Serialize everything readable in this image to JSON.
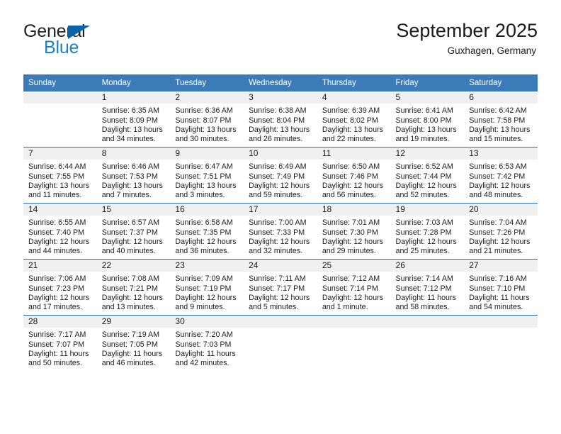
{
  "brand": {
    "name_top": "General",
    "name_bottom": "Blue",
    "accent_color": "#1f7fc4",
    "triangle_color": "#0b63a8",
    "triangle_icon": "triangle-icon"
  },
  "header": {
    "title": "September 2025",
    "subtitle": "Guxhagen, Germany"
  },
  "theme": {
    "header_bg": "#3b7cb8",
    "row_divider": "#2e6da4",
    "daynum_bg": "#f0f0f0",
    "text": "#1a1a1a"
  },
  "weekday_headers": [
    "Sunday",
    "Monday",
    "Tuesday",
    "Wednesday",
    "Thursday",
    "Friday",
    "Saturday"
  ],
  "weeks": [
    [
      {
        "day": "",
        "lines": []
      },
      {
        "day": "1",
        "lines": [
          "Sunrise: 6:35 AM",
          "Sunset: 8:09 PM",
          "Daylight: 13 hours",
          "and 34 minutes."
        ]
      },
      {
        "day": "2",
        "lines": [
          "Sunrise: 6:36 AM",
          "Sunset: 8:07 PM",
          "Daylight: 13 hours",
          "and 30 minutes."
        ]
      },
      {
        "day": "3",
        "lines": [
          "Sunrise: 6:38 AM",
          "Sunset: 8:04 PM",
          "Daylight: 13 hours",
          "and 26 minutes."
        ]
      },
      {
        "day": "4",
        "lines": [
          "Sunrise: 6:39 AM",
          "Sunset: 8:02 PM",
          "Daylight: 13 hours",
          "and 22 minutes."
        ]
      },
      {
        "day": "5",
        "lines": [
          "Sunrise: 6:41 AM",
          "Sunset: 8:00 PM",
          "Daylight: 13 hours",
          "and 19 minutes."
        ]
      },
      {
        "day": "6",
        "lines": [
          "Sunrise: 6:42 AM",
          "Sunset: 7:58 PM",
          "Daylight: 13 hours",
          "and 15 minutes."
        ]
      }
    ],
    [
      {
        "day": "7",
        "lines": [
          "Sunrise: 6:44 AM",
          "Sunset: 7:55 PM",
          "Daylight: 13 hours",
          "and 11 minutes."
        ]
      },
      {
        "day": "8",
        "lines": [
          "Sunrise: 6:46 AM",
          "Sunset: 7:53 PM",
          "Daylight: 13 hours",
          "and 7 minutes."
        ]
      },
      {
        "day": "9",
        "lines": [
          "Sunrise: 6:47 AM",
          "Sunset: 7:51 PM",
          "Daylight: 13 hours",
          "and 3 minutes."
        ]
      },
      {
        "day": "10",
        "lines": [
          "Sunrise: 6:49 AM",
          "Sunset: 7:49 PM",
          "Daylight: 12 hours",
          "and 59 minutes."
        ]
      },
      {
        "day": "11",
        "lines": [
          "Sunrise: 6:50 AM",
          "Sunset: 7:46 PM",
          "Daylight: 12 hours",
          "and 56 minutes."
        ]
      },
      {
        "day": "12",
        "lines": [
          "Sunrise: 6:52 AM",
          "Sunset: 7:44 PM",
          "Daylight: 12 hours",
          "and 52 minutes."
        ]
      },
      {
        "day": "13",
        "lines": [
          "Sunrise: 6:53 AM",
          "Sunset: 7:42 PM",
          "Daylight: 12 hours",
          "and 48 minutes."
        ]
      }
    ],
    [
      {
        "day": "14",
        "lines": [
          "Sunrise: 6:55 AM",
          "Sunset: 7:40 PM",
          "Daylight: 12 hours",
          "and 44 minutes."
        ]
      },
      {
        "day": "15",
        "lines": [
          "Sunrise: 6:57 AM",
          "Sunset: 7:37 PM",
          "Daylight: 12 hours",
          "and 40 minutes."
        ]
      },
      {
        "day": "16",
        "lines": [
          "Sunrise: 6:58 AM",
          "Sunset: 7:35 PM",
          "Daylight: 12 hours",
          "and 36 minutes."
        ]
      },
      {
        "day": "17",
        "lines": [
          "Sunrise: 7:00 AM",
          "Sunset: 7:33 PM",
          "Daylight: 12 hours",
          "and 32 minutes."
        ]
      },
      {
        "day": "18",
        "lines": [
          "Sunrise: 7:01 AM",
          "Sunset: 7:30 PM",
          "Daylight: 12 hours",
          "and 29 minutes."
        ]
      },
      {
        "day": "19",
        "lines": [
          "Sunrise: 7:03 AM",
          "Sunset: 7:28 PM",
          "Daylight: 12 hours",
          "and 25 minutes."
        ]
      },
      {
        "day": "20",
        "lines": [
          "Sunrise: 7:04 AM",
          "Sunset: 7:26 PM",
          "Daylight: 12 hours",
          "and 21 minutes."
        ]
      }
    ],
    [
      {
        "day": "21",
        "lines": [
          "Sunrise: 7:06 AM",
          "Sunset: 7:23 PM",
          "Daylight: 12 hours",
          "and 17 minutes."
        ]
      },
      {
        "day": "22",
        "lines": [
          "Sunrise: 7:08 AM",
          "Sunset: 7:21 PM",
          "Daylight: 12 hours",
          "and 13 minutes."
        ]
      },
      {
        "day": "23",
        "lines": [
          "Sunrise: 7:09 AM",
          "Sunset: 7:19 PM",
          "Daylight: 12 hours",
          "and 9 minutes."
        ]
      },
      {
        "day": "24",
        "lines": [
          "Sunrise: 7:11 AM",
          "Sunset: 7:17 PM",
          "Daylight: 12 hours",
          "and 5 minutes."
        ]
      },
      {
        "day": "25",
        "lines": [
          "Sunrise: 7:12 AM",
          "Sunset: 7:14 PM",
          "Daylight: 12 hours",
          "and 1 minute."
        ]
      },
      {
        "day": "26",
        "lines": [
          "Sunrise: 7:14 AM",
          "Sunset: 7:12 PM",
          "Daylight: 11 hours",
          "and 58 minutes."
        ]
      },
      {
        "day": "27",
        "lines": [
          "Sunrise: 7:16 AM",
          "Sunset: 7:10 PM",
          "Daylight: 11 hours",
          "and 54 minutes."
        ]
      }
    ],
    [
      {
        "day": "28",
        "lines": [
          "Sunrise: 7:17 AM",
          "Sunset: 7:07 PM",
          "Daylight: 11 hours",
          "and 50 minutes."
        ]
      },
      {
        "day": "29",
        "lines": [
          "Sunrise: 7:19 AM",
          "Sunset: 7:05 PM",
          "Daylight: 11 hours",
          "and 46 minutes."
        ]
      },
      {
        "day": "30",
        "lines": [
          "Sunrise: 7:20 AM",
          "Sunset: 7:03 PM",
          "Daylight: 11 hours",
          "and 42 minutes."
        ]
      },
      {
        "day": "",
        "lines": []
      },
      {
        "day": "",
        "lines": []
      },
      {
        "day": "",
        "lines": []
      },
      {
        "day": "",
        "lines": []
      }
    ]
  ]
}
